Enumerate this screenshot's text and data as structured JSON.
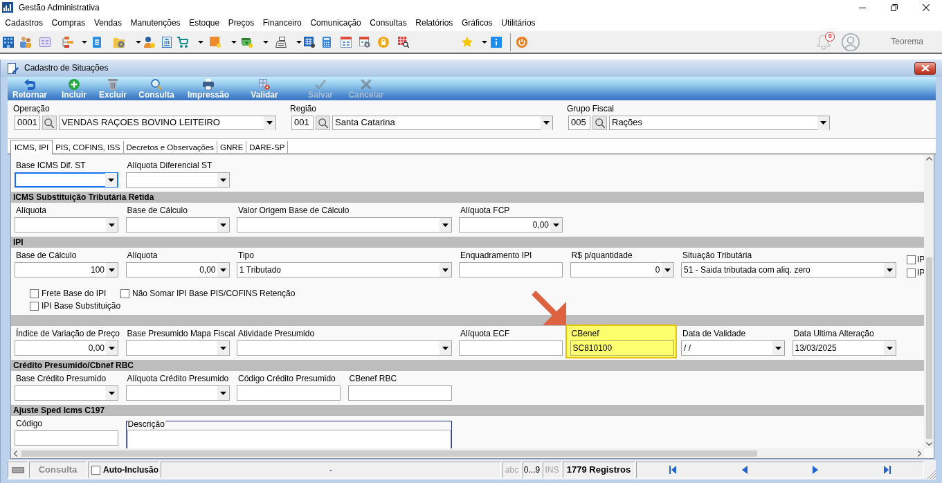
{
  "window": {
    "title": "Gestão Administrativa"
  },
  "menu": [
    "Cadastros",
    "Compras",
    "Vendas",
    "Manutenções",
    "Estoque",
    "Preços",
    "Financeiro",
    "Comunicação",
    "Consultas",
    "Relatórios",
    "Gráficos",
    "Utilitários"
  ],
  "toolbar": {
    "notifications": "0",
    "user": "Teorema"
  },
  "form": {
    "title": "Cadastro de Situações",
    "actions": [
      {
        "label": "Retornar",
        "disabled": false
      },
      {
        "label": "Incluir",
        "disabled": false
      },
      {
        "label": "Excluir",
        "disabled": false
      },
      {
        "label": "Consulta",
        "disabled": false
      },
      {
        "label": "Impressão",
        "disabled": false
      },
      {
        "label": "Validar",
        "disabled": false
      },
      {
        "label": "Salvar",
        "disabled": true
      },
      {
        "label": "Cancelar",
        "disabled": true
      }
    ],
    "filters": [
      {
        "label": "Operação",
        "code": "0001",
        "value": "VENDAS RAÇOES BOVINO LEITEIRO"
      },
      {
        "label": "Região",
        "code": "001",
        "value": "Santa Catarina"
      },
      {
        "label": "Grupo Fiscal",
        "code": "005",
        "value": "Rações"
      }
    ],
    "tabs": [
      {
        "label": "ICMS, IPI",
        "selected": true
      },
      {
        "label": "PIS, COFINS, ISS",
        "selected": false
      },
      {
        "label": "Decretos e Observações",
        "selected": false
      },
      {
        "label": "GNRE",
        "selected": false
      },
      {
        "label": "DARE-SP",
        "selected": false
      }
    ],
    "fields": [
      {
        "kind": "combo",
        "label": "Base ICMS Dif. ST",
        "focused": true,
        "highlighted": false
      },
      {
        "kind": "combo",
        "label": "Alíquota Diferencial ST",
        "focused": false,
        "highlighted": false
      }
    ],
    "sections": [
      {
        "title": "ICMS Substituição Tributária Retida",
        "fields": [
          {
            "kind": "combo",
            "label": "Alíquota",
            "focused": false,
            "highlighted": false
          },
          {
            "kind": "combo",
            "label": "Base de Cálculo",
            "focused": false,
            "highlighted": false
          },
          {
            "kind": "combo",
            "label": "Valor Origem Base de Cálculo",
            "focused": false,
            "highlighted": false
          },
          {
            "kind": "numeric",
            "label": "Alíquota FCP",
            "value": "0,00",
            "focused": false,
            "highlighted": false
          }
        ]
      },
      {
        "title": "IPI",
        "fields": [
          {
            "kind": "numeric",
            "label": "Base de Cálculo",
            "value": "100",
            "focused": false,
            "highlighted": false
          },
          {
            "kind": "numeric",
            "label": "Alíquota",
            "value": "0,00",
            "focused": false,
            "highlighted": false
          },
          {
            "kind": "combo",
            "label": "Tipo",
            "value": "1 Tributado",
            "focused": false,
            "highlighted": false
          },
          {
            "kind": "text",
            "label": "Enquadramento IPI",
            "focused": false,
            "highlighted": false
          },
          {
            "kind": "numeric",
            "label": "R$ p/quantidade",
            "value": "0",
            "focused": false,
            "highlighted": false
          },
          {
            "kind": "combo",
            "label": "Situação Tributária",
            "value": "51 - Saida tributada com aliq. zero",
            "focused": false,
            "highlighted": false
          }
        ],
        "side_checks": [
          {
            "label": "IP",
            "checked": false
          },
          {
            "label": "IP",
            "checked": false
          }
        ],
        "checks": [
          {
            "label": "Frete Base do IPI",
            "checked": false
          },
          {
            "label": "Não Somar IPI Base PIS/COFINS Retenção",
            "checked": false
          },
          {
            "label": "IPI Base Substituição",
            "checked": false
          }
        ]
      },
      {
        "fields": [
          {
            "kind": "numeric",
            "label": "Índice de Variação de Preço",
            "value": "0,00",
            "focused": false,
            "highlighted": false
          },
          {
            "kind": "combo",
            "label": "Base Presumido Mapa Fiscal",
            "focused": false,
            "highlighted": false
          },
          {
            "kind": "combo",
            "label": "Atividade Presumido",
            "focused": false,
            "highlighted": false
          },
          {
            "kind": "text",
            "label": "Alíquota ECF",
            "focused": false,
            "highlighted": false
          },
          {
            "kind": "text",
            "label": "CBenef",
            "value": "SC810100",
            "focused": false,
            "highlighted": true
          },
          {
            "kind": "combo",
            "label": "Data de Validade",
            "value": "/ /",
            "focused": false,
            "highlighted": false
          },
          {
            "kind": "combo",
            "label": "Data Ultima Alteração",
            "value": "13/03/2025",
            "focused": false,
            "highlighted": false
          }
        ]
      },
      {
        "title": "Crédito Presumido/Cbnef RBC",
        "fields": [
          {
            "kind": "combo",
            "label": "Base Crédito Presumido",
            "focused": false,
            "highlighted": false
          },
          {
            "kind": "combo",
            "label": "Alíquota Crédito Presumido",
            "focused": false,
            "highlighted": false
          },
          {
            "kind": "text",
            "label": "Código Crédito Presumido",
            "focused": false,
            "highlighted": false
          },
          {
            "kind": "text",
            "label": "CBenef RBC",
            "focused": false,
            "highlighted": false
          }
        ]
      },
      {
        "title": "Ajuste Sped Icms C197",
        "fields": [
          {
            "kind": "text",
            "label": "Código",
            "focused": false,
            "highlighted": false
          },
          {
            "kind": "memo",
            "label": "Descrição",
            "focused": false,
            "highlighted": false
          }
        ]
      }
    ]
  },
  "status_bar": {
    "mode": "Consulta",
    "auto_inclusion": {
      "label": "Auto-Inclusão",
      "checked": false
    },
    "message": "-",
    "indicators": [
      {
        "label": "abc",
        "on": false
      },
      {
        "label": "0...9",
        "on": true
      },
      {
        "label": "INS",
        "on": false
      }
    ],
    "records": "1779 Registros"
  }
}
